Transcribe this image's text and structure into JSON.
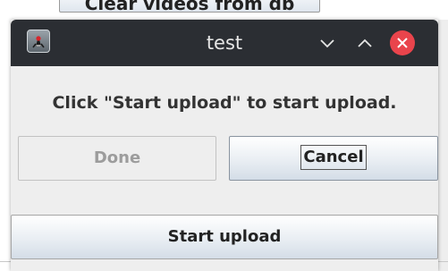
{
  "background_window": {
    "partial_button_label": "Clear videos from db"
  },
  "dialog": {
    "title": "test",
    "app_icon": "java-duke-icon",
    "controls": {
      "minimize_icon": "chevron-down-icon",
      "maximize_icon": "chevron-up-icon",
      "close_icon": "close-icon"
    },
    "message": "Click \"Start upload\" to start upload.",
    "buttons": {
      "done_label": "Done",
      "cancel_label": "Cancel",
      "start_label": "Start upload"
    }
  },
  "colors": {
    "titlebar": "#2b2e33",
    "close_button": "#e9444c",
    "dialog_background": "#eeeeee",
    "disabled_text": "#9c9c9c"
  }
}
